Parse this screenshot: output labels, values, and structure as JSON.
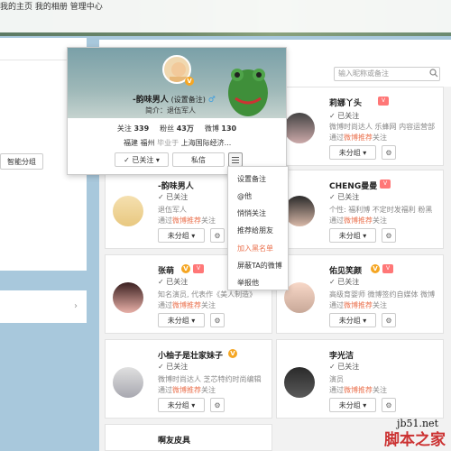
{
  "nav": {
    "home": "我的主页",
    "album": "我的相册",
    "admin": "管理中心"
  },
  "left": {
    "smart_group": "智能分组",
    "chevron": "›"
  },
  "search": {
    "placeholder": "输入昵称或备注"
  },
  "popup": {
    "name": "-韵味男人",
    "remark": "(设置备注)",
    "gender": "♂",
    "intro": "简介：退伍军人",
    "follow_label": "关注",
    "follow_count": "339",
    "fans_label": "粉丝",
    "fans_count": "43万",
    "weibo_label": "微博",
    "weibo_count": "130",
    "location": "福建 福州",
    "school_label": "毕业于",
    "school": "上海国际经济...",
    "followed_btn": "✓ 已关注 ▾",
    "message_btn": "私信"
  },
  "dropdown": {
    "items": [
      "设置备注",
      "@他",
      "悄悄关注",
      "推荐给朋友",
      "加入黑名单",
      "屏蔽TA的微博",
      "举报他"
    ]
  },
  "cards": [
    {
      "name": "莉娜丫头",
      "followed": "✓ 已关注",
      "desc": "微博时尚达人 乐蜂网 内容运营部",
      "via_pre": "通过",
      "via_hl": "微博推荐",
      "via_post": "关注",
      "group": "未分组 ▾"
    },
    {
      "name": "-韵味男人",
      "followed": "✓ 已关注",
      "desc": "退伍军人",
      "via_pre": "通过",
      "via_hl": "微博推荐",
      "via_post": "关注",
      "group": "未分组 ▾"
    },
    {
      "name": "CHENG曼曼",
      "followed": "✓ 已关注",
      "desc": "个性: 福利博 不定时发福利 粉黑",
      "via_pre": "通过",
      "via_hl": "微博推荐",
      "via_post": "关注",
      "group": "未分组 ▾"
    },
    {
      "name": "张萌",
      "followed": "✓ 已关注",
      "desc": "知名演员, 代表作《美人制造》",
      "via_pre": "通过",
      "via_hl": "微博推荐",
      "via_post": "关注",
      "group": "未分组 ▾"
    },
    {
      "name": "佑见笑颜",
      "followed": "✓ 已关注",
      "desc": "高级育婴师 微博签约自媒体 微博",
      "via_pre": "通过",
      "via_hl": "微博推荐",
      "via_post": "关注",
      "group": "未分组 ▾"
    },
    {
      "name": "小柚子是壮家妹子",
      "followed": "✓ 已关注",
      "desc": "微博时尚达人 芝芯特约时尚编辑",
      "via_pre": "通过",
      "via_hl": "微博推荐",
      "via_post": "关注",
      "group": "未分组 ▾"
    },
    {
      "name": "李光洁",
      "followed": "✓ 已关注",
      "desc": "演员",
      "via_pre": "通过",
      "via_hl": "微博推荐",
      "via_post": "关注",
      "group": "未分组 ▾"
    },
    {
      "name": "啊友皮具"
    }
  ],
  "watermark": {
    "site": "jb51.net",
    "brand": "脚本之家"
  },
  "colors": {
    "accent": "#eb7350",
    "vbadge": "#f5a623"
  }
}
